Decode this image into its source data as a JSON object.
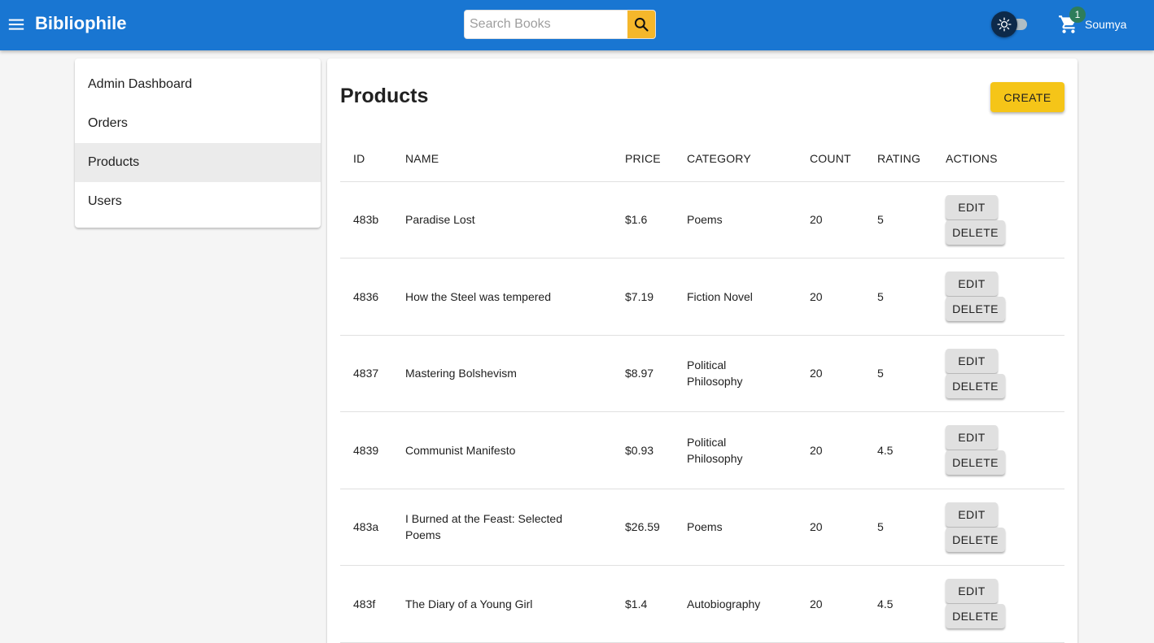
{
  "app": {
    "brand": "Bibliophile",
    "search_placeholder": "Search Books",
    "cart_count": "1",
    "username": "Soumya"
  },
  "sidebar": {
    "items": [
      {
        "label": "Admin Dashboard",
        "active": false
      },
      {
        "label": "Orders",
        "active": false
      },
      {
        "label": "Products",
        "active": true
      },
      {
        "label": "Users",
        "active": false
      }
    ]
  },
  "main": {
    "title": "Products",
    "create_label": "CREATE",
    "columns": [
      "ID",
      "NAME",
      "PRICE",
      "CATEGORY",
      "COUNT",
      "RATING",
      "ACTIONS"
    ],
    "edit_label": "EDIT",
    "delete_label": "DELETE",
    "rows": [
      {
        "id": "483b",
        "name": "Paradise Lost",
        "price": "$1.6",
        "category": "Poems",
        "count": "20",
        "rating": "5"
      },
      {
        "id": "4836",
        "name": "How the Steel was tempered",
        "price": "$7.19",
        "category": "Fiction Novel",
        "count": "20",
        "rating": "5"
      },
      {
        "id": "4837",
        "name": "Mastering Bolshevism",
        "price": "$8.97",
        "category": "Political Philosophy",
        "count": "20",
        "rating": "5"
      },
      {
        "id": "4839",
        "name": "Communist Manifesto",
        "price": "$0.93",
        "category": "Political Philosophy",
        "count": "20",
        "rating": "4.5"
      },
      {
        "id": "483a",
        "name": "I Burned at the Feast: Selected Poems",
        "price": "$26.59",
        "category": "Poems",
        "count": "20",
        "rating": "5"
      },
      {
        "id": "483f",
        "name": "The Diary of a Young Girl",
        "price": "$1.4",
        "category": "Autobiography",
        "count": "20",
        "rating": "4.5"
      }
    ]
  },
  "colors": {
    "appbar": "#1976d2",
    "search_button": "#f5b72b",
    "create_button": "#f5c518",
    "badge": "#2e7d5a"
  },
  "icons": {
    "menu": "menu-icon",
    "search": "search-icon",
    "theme": "sun-icon",
    "cart": "cart-icon"
  }
}
